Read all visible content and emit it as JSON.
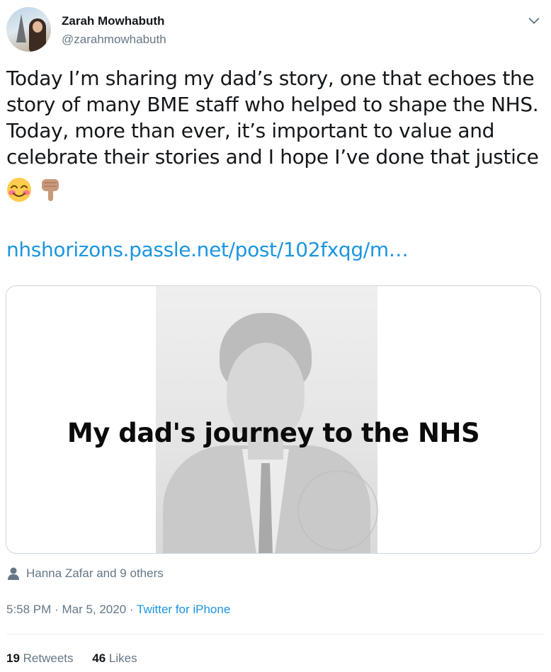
{
  "author": {
    "name": "Zarah Mowhabuth",
    "handle": "@zarahmowhabuth"
  },
  "tweet": {
    "text": "Today I’m sharing my dad’s story, one that echoes the\nstory of many BME staff who helped to shape the NHS.\nToday, more than ever, it’s important to value and\ncelebrate their stories and I hope I’ve done that justice",
    "emojis": [
      "smiling-face-with-smiling-eyes",
      "backhand-index-pointing-down"
    ],
    "link": "nhshorizons.passle.net/post/102fxqg/m…"
  },
  "media": {
    "overlay_text": "My dad's journey to the NHS"
  },
  "tagged": {
    "text": "Hanna Zafar and 9 others"
  },
  "meta": {
    "time": "5:58 PM",
    "separator": "·",
    "date": "Mar 5, 2020",
    "source": "Twitter for iPhone"
  },
  "stats": {
    "retweets_count": "19",
    "retweets_label": "Retweets",
    "likes_count": "46",
    "likes_label": "Likes"
  },
  "colors": {
    "link": "#1b95e0",
    "secondary_text": "#657786",
    "primary_text": "#14171a",
    "border": "#ccd6dd"
  }
}
